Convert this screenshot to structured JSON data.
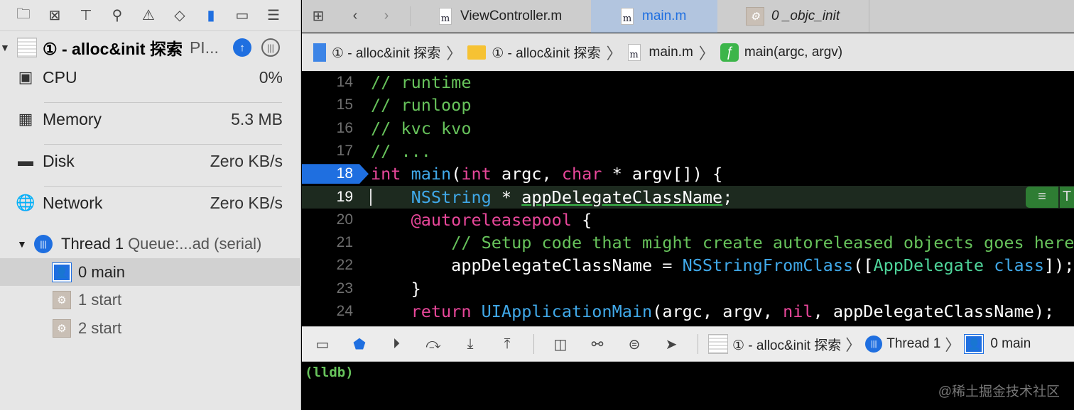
{
  "navigator": {
    "icons": [
      "folder-icon",
      "source-control-icon",
      "hierarchy-icon",
      "search-icon",
      "warning-icon",
      "test-icon",
      "debug-icon",
      "breakpoint-icon",
      "report-icon"
    ]
  },
  "process": {
    "title": "① - alloc&init 探索",
    "suffix": "PI..."
  },
  "gauges": [
    {
      "label": "CPU",
      "value": "0%"
    },
    {
      "label": "Memory",
      "value": "5.3 MB"
    },
    {
      "label": "Disk",
      "value": "Zero KB/s"
    },
    {
      "label": "Network",
      "value": "Zero KB/s"
    }
  ],
  "thread": {
    "name": "Thread 1",
    "queue": "Queue:...ad (serial)"
  },
  "frames": [
    {
      "label": "0 main",
      "selected": true
    },
    {
      "label": "1 start"
    },
    {
      "label": "2 start"
    }
  ],
  "tabs": [
    {
      "label": "ViewController.m",
      "icon": "m"
    },
    {
      "label": "main.m",
      "icon": "m",
      "active": true
    },
    {
      "label": "0 _objc_init"
    }
  ],
  "breadcrumb": [
    "① - alloc&init 探索",
    "① - alloc&init 探索",
    "main.m",
    "main(argc, argv)"
  ],
  "breadcrumb_icons": {
    "file": "m",
    "func": "ƒ"
  },
  "code": [
    {
      "n": "14",
      "t": [
        [
          "cm",
          "// runtime"
        ]
      ]
    },
    {
      "n": "15",
      "t": [
        [
          "cm",
          "// runloop"
        ]
      ]
    },
    {
      "n": "16",
      "t": [
        [
          "cm",
          "// kvc kvo"
        ]
      ]
    },
    {
      "n": "17",
      "t": [
        [
          "cm",
          "// ..."
        ]
      ]
    },
    {
      "n": "18",
      "bp": true,
      "t": [
        [
          "kw",
          "int"
        ],
        [
          "pl",
          " "
        ],
        [
          "ty",
          "main"
        ],
        [
          "pl",
          "("
        ],
        [
          "kw",
          "int"
        ],
        [
          "pl",
          " argc, "
        ],
        [
          "kw",
          "char"
        ],
        [
          "pl",
          " * argv[]) {"
        ]
      ]
    },
    {
      "n": "19",
      "cur": true,
      "t": [
        [
          "pl",
          "    "
        ],
        [
          "ty",
          "NSString"
        ],
        [
          "pl",
          " * "
        ],
        [
          "pl ul",
          "appDelegateClassName"
        ],
        [
          "pl",
          ";"
        ]
      ]
    },
    {
      "n": "20",
      "t": [
        [
          "pl",
          "    "
        ],
        [
          "kw",
          "@autoreleasepool"
        ],
        [
          "pl",
          " {"
        ]
      ]
    },
    {
      "n": "21",
      "t": [
        [
          "pl",
          "        "
        ],
        [
          "cm",
          "// Setup code that might create autoreleased objects goes here."
        ]
      ]
    },
    {
      "n": "22",
      "t": [
        [
          "pl",
          "        appDelegateClassName = "
        ],
        [
          "ty",
          "NSStringFromClass"
        ],
        [
          "pl",
          "(["
        ],
        [
          "cls",
          "AppDelegate"
        ],
        [
          "pl",
          " "
        ],
        [
          "ty",
          "class"
        ],
        [
          "pl",
          "]);"
        ]
      ]
    },
    {
      "n": "23",
      "t": [
        [
          "pl",
          "    }"
        ]
      ]
    },
    {
      "n": "24",
      "t": [
        [
          "pl",
          "    "
        ],
        [
          "kw",
          "return"
        ],
        [
          "pl",
          " "
        ],
        [
          "ty",
          "UIApplicationMain"
        ],
        [
          "pl",
          "(argc, argv, "
        ],
        [
          "kw",
          "nil"
        ],
        [
          "pl",
          ", appDelegateClassName);"
        ]
      ]
    }
  ],
  "line_badge": {
    "menu": "≡",
    "label": "T"
  },
  "debug_bar": {
    "process": "① - alloc&init 探索",
    "thread": "Thread 1",
    "frame": "0 main"
  },
  "console": {
    "prompt": "(lldb)",
    "watermark": "@稀土掘金技术社区"
  },
  "colors": {
    "accent": "#1f6fe0",
    "comment": "#67c35b",
    "keyword": "#e8479a"
  }
}
